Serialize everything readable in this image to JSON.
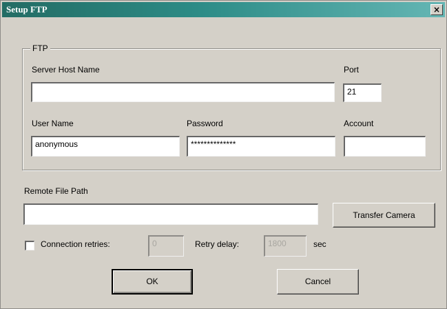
{
  "window": {
    "title": "Setup FTP",
    "close_label": "×"
  },
  "ftp_group": {
    "title": "FTP",
    "server_host_name": {
      "label": "Server Host Name",
      "value": ""
    },
    "port": {
      "label": "Port",
      "value": "21"
    },
    "user_name": {
      "label": "User Name",
      "value": "anonymous"
    },
    "password": {
      "label": "Password",
      "value": "**************"
    },
    "account": {
      "label": "Account",
      "value": ""
    }
  },
  "remote_file_path": {
    "label": "Remote File Path",
    "value": ""
  },
  "transfer_camera_label": "Transfer Camera",
  "connection_retries": {
    "label": "Connection retries:",
    "checked": false,
    "value": "0"
  },
  "retry_delay": {
    "label": "Retry delay:",
    "value": "1800",
    "unit": "sec"
  },
  "buttons": {
    "ok": "OK",
    "cancel": "Cancel"
  }
}
